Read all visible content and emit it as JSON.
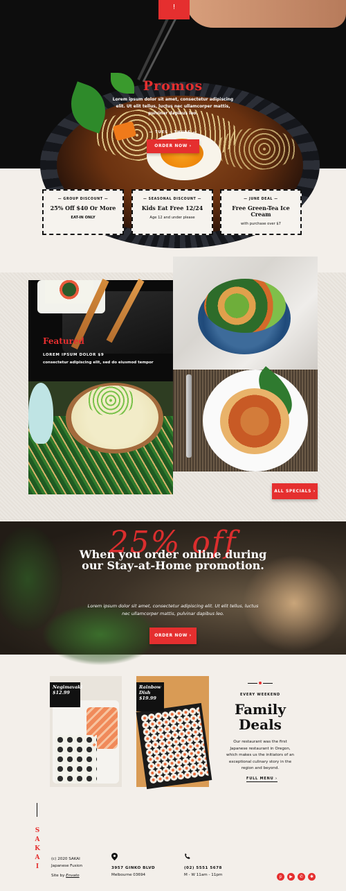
{
  "hero": {
    "tab_glyph": "!",
    "title": "Promos",
    "text": "Lorem ipsum dolor sit amet, consectetur adipiscing elit. Ut elit tellus, luctus nec ullamcorper mattis, pulvinar dapibus leo.",
    "hours": "— TUES – THURS —",
    "order_label": "ORDER NOW ›"
  },
  "promos": [
    {
      "label": "— GROUP DISCOUNT —",
      "title": "25% Off $40 Or More",
      "sub": "EAT-IN ONLY"
    },
    {
      "label": "— SEASONAL DISCOUNT —",
      "title": "Kids Eat Free 12/24",
      "sub": "Age 12 and under please"
    },
    {
      "label": "— JUNE DEAL —",
      "title": "Free Green-Tea Ice Cream",
      "sub": "with purchase over $7"
    }
  ],
  "featured": {
    "title": "Featured",
    "line1": "LOREM IPSUM DOLOR $9",
    "line2": "consectetur adipiscing elit, sed do eiusmod tempor",
    "specials_label": "ALL SPECIALS ›"
  },
  "banner": {
    "percent": "25% off",
    "title": "When you order online during our Stay-at-Home promotion.",
    "text": "Lorem ipsum dolor sit amet, consectetur adipiscing elit. Ut elit tellus, luctus nec ullamcorper mattis, pulvinar dapibus leo.",
    "order_label": "ORDER NOW ›"
  },
  "deals": {
    "items": [
      {
        "name": "Negimavaki",
        "price": "$12.99"
      },
      {
        "name": "Rainbow Dish",
        "price": "$19.99"
      }
    ],
    "eyebrow": "EVERY WEEKEND",
    "title": "Family Deals",
    "text": "Our restaurant  was the first Japanese restaurant in Oregon, which makes us the initiators of an exceptional culinary story in the region and beyond.",
    "menu_label": "FULL MENU ›"
  },
  "footer": {
    "brand_letters": [
      "S",
      "A",
      "K",
      "A",
      "I"
    ],
    "copyright": "(c) 2020 SAKAI",
    "tagline": "Japanese Fusion",
    "site_by": "Site by",
    "site_by_link": "Envato",
    "address_line1": "3957 GINKO BLVD",
    "address_line2": "Melbourne 03694",
    "phone": "(02) 5551 5678",
    "hours": "M - W 11am - 11pm",
    "social_icons": [
      "pinterest-icon",
      "youtube-icon",
      "whatsapp-icon",
      "yelp-icon"
    ]
  },
  "colors": {
    "accent": "#e52f2f",
    "background": "#f3efea",
    "dark": "#111111"
  }
}
